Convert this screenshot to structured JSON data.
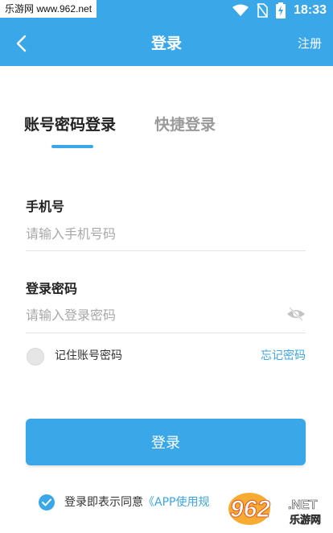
{
  "status_bar": {
    "watermark": "乐游网 www.962.net",
    "time": "18:33"
  },
  "header": {
    "title": "登录",
    "register_label": "注册"
  },
  "tabs": [
    {
      "label": "账号密码登录",
      "active": true
    },
    {
      "label": "快捷登录",
      "active": false
    }
  ],
  "form": {
    "phone_label": "手机号",
    "phone_placeholder": "请输入手机号码",
    "phone_value": "",
    "password_label": "登录密码",
    "password_placeholder": "请输入登录密码",
    "password_value": "",
    "remember_label": "记住账号密码",
    "remember_checked": false,
    "forgot_label": "忘记密码"
  },
  "login_button": "登录",
  "agreement": {
    "prefix": "登录即表示同意",
    "link": "《APP使用规",
    "checked": true
  },
  "logo": {
    "text": "962",
    "subtext": "乐游网",
    "domain": ".NET"
  },
  "colors": {
    "accent": "#3aa7e8",
    "inactive_tab": "#9a9a9a",
    "placeholder": "#a8a8a8"
  }
}
